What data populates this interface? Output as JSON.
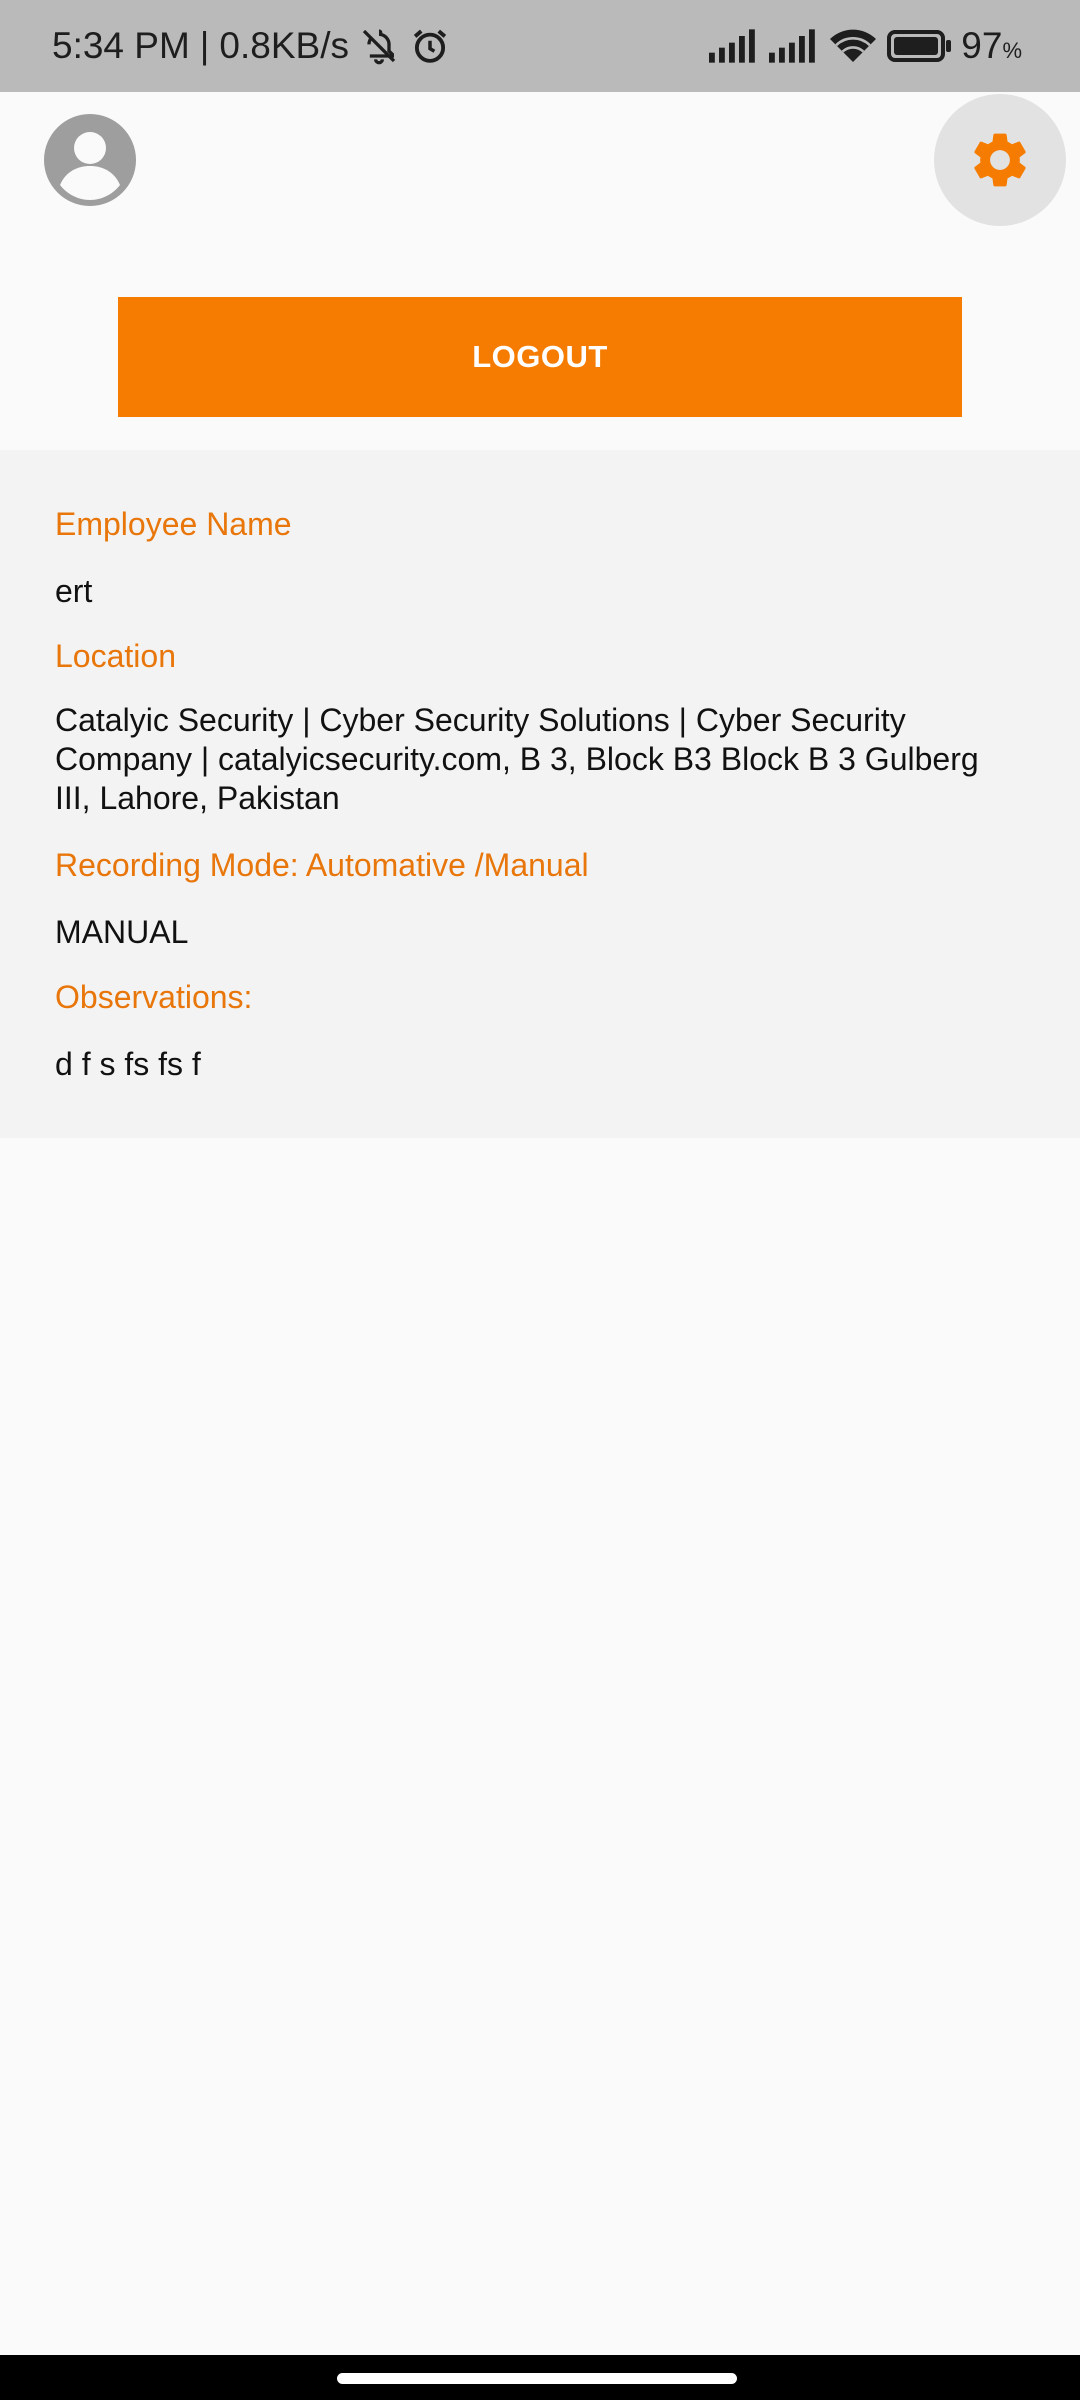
{
  "status_bar": {
    "time": "5:34 PM",
    "separator": "|",
    "net_speed": "0.8KB/s",
    "battery_level": "97",
    "battery_unit": "%",
    "icons": [
      "mute-icon",
      "alarm-icon",
      "signal-icon",
      "signal-icon",
      "wifi-icon",
      "battery-icon"
    ]
  },
  "header": {
    "avatar_icon": "account-circle-icon",
    "settings_icon": "gear-icon",
    "logout_label": "LOGOUT"
  },
  "details": {
    "employee_name_label": "Employee Name",
    "employee_name": "ert",
    "location_label": "Location",
    "location": "Catalyic Security | Cyber Security Solutions | Cyber Security Company | catalyicsecurity.com, B 3, Block B3 Block B 3 Gulberg III, Lahore, Pakistan",
    "recording_mode_label": "Recording Mode: Automative /Manual",
    "recording_mode": "MANUAL",
    "observations_label": "Observations:",
    "observations": "d f s fs fs f"
  },
  "colors": {
    "accent": "#f57c00",
    "label": "#e8760a",
    "status_bar_bg": "#bababa",
    "card_bg": "#f3f3f3"
  }
}
